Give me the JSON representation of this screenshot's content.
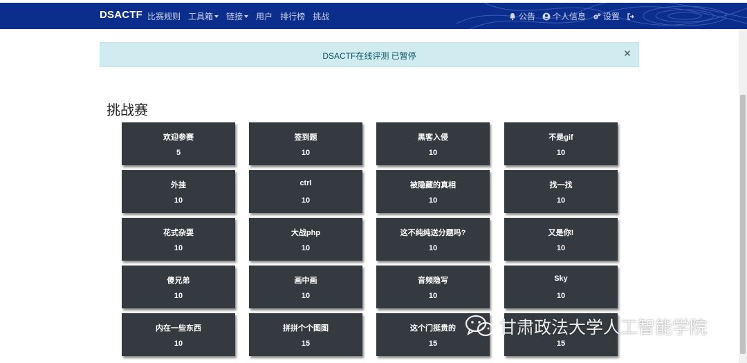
{
  "navbar": {
    "brand": "DSACTF",
    "left_items": [
      {
        "label": "比赛规则",
        "dropdown": false
      },
      {
        "label": "工具箱",
        "dropdown": true
      },
      {
        "label": "链接",
        "dropdown": true
      },
      {
        "label": "用户",
        "dropdown": false
      },
      {
        "label": "排行榜",
        "dropdown": false
      },
      {
        "label": "挑战",
        "dropdown": false
      }
    ],
    "right_items": [
      {
        "label": "公告",
        "icon": "bell-icon"
      },
      {
        "label": "个人信息",
        "icon": "user-circle-icon"
      },
      {
        "label": "设置",
        "icon": "gears-icon"
      },
      {
        "label": "",
        "icon": "sign-out-icon"
      }
    ],
    "color": "#0b2e8c"
  },
  "alert": {
    "message": "DSACTF在线评测 已暂停",
    "close_symbol": "×"
  },
  "page": {
    "title": "挑战赛"
  },
  "challenges": [
    [
      {
        "name": "欢迎参赛",
        "score": "5"
      },
      {
        "name": "签到题",
        "score": "10"
      },
      {
        "name": "黑客入侵",
        "score": "10"
      },
      {
        "name": "不是gif",
        "score": "10"
      }
    ],
    [
      {
        "name": "外挂",
        "score": "10"
      },
      {
        "name": "ctrl",
        "score": "10"
      },
      {
        "name": "被隐藏的真相",
        "score": "10"
      },
      {
        "name": "找一找",
        "score": "10"
      }
    ],
    [
      {
        "name": "花式杂耍",
        "score": "10"
      },
      {
        "name": "大战php",
        "score": "10"
      },
      {
        "name": "这不纯纯送分题吗?",
        "score": "10"
      },
      {
        "name": "又是你!",
        "score": "10"
      }
    ],
    [
      {
        "name": "傻兄弟",
        "score": "10"
      },
      {
        "name": "画中画",
        "score": "10"
      },
      {
        "name": "音频隐写",
        "score": "10"
      },
      {
        "name": "Sky",
        "score": "10"
      }
    ],
    [
      {
        "name": "内在一些东西",
        "score": "10"
      },
      {
        "name": "拼拼个个图图",
        "score": "15"
      },
      {
        "name": "这个门挺贵的",
        "score": "15"
      },
      {
        "name": "",
        "score": "15"
      }
    ]
  ],
  "watermark": {
    "text": "甘肃政法大学人工智能学院",
    "icon": "wechat-icon"
  }
}
